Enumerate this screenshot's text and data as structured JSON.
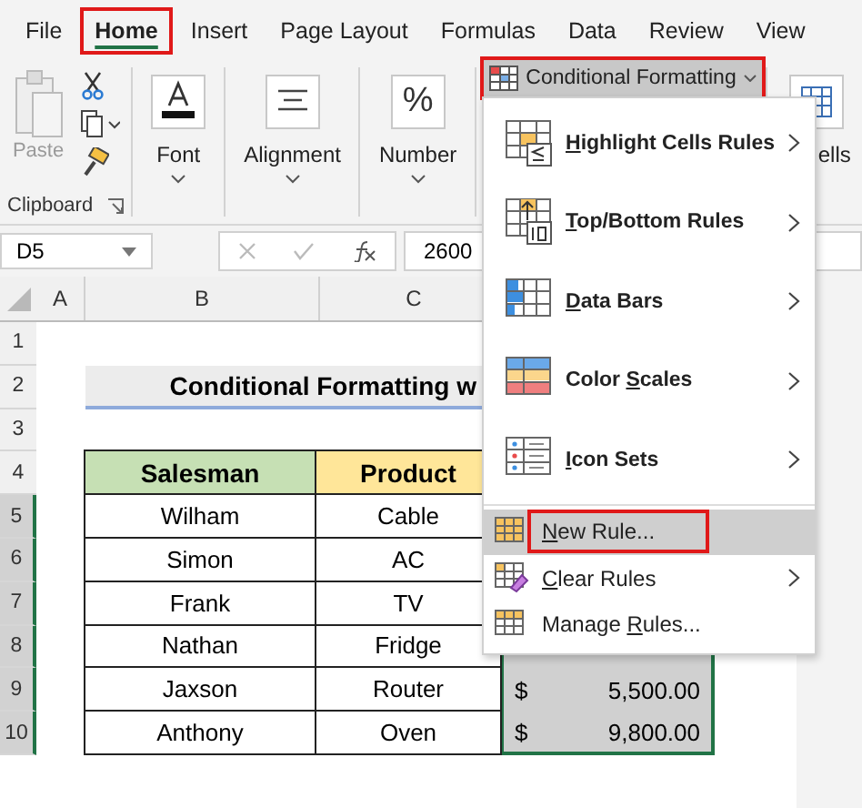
{
  "ribbon_tabs": [
    {
      "label": "File",
      "selected": false
    },
    {
      "label": "Home",
      "selected": true
    },
    {
      "label": "Insert",
      "selected": false
    },
    {
      "label": "Page Layout",
      "selected": false
    },
    {
      "label": "Formulas",
      "selected": false
    },
    {
      "label": "Data",
      "selected": false
    },
    {
      "label": "Review",
      "selected": false
    },
    {
      "label": "View",
      "selected": false
    }
  ],
  "clipboard": {
    "paste": "Paste",
    "group": "Clipboard"
  },
  "groups": [
    {
      "label": "Font",
      "kind": "font"
    },
    {
      "label": "Alignment",
      "kind": "align"
    },
    {
      "label": "Number",
      "kind": "number",
      "glyph": "%"
    }
  ],
  "conditional_formatting": {
    "label": "Conditional Formatting"
  },
  "cells_group": {
    "label": "ells"
  },
  "formula_bar": {
    "name_box": "D5",
    "value": "2600"
  },
  "columns": [
    "A",
    "B",
    "C"
  ],
  "title": "Conditional Formatting w",
  "headers": [
    {
      "label": "Salesman",
      "color": "#c6e0b4"
    },
    {
      "label": "Product",
      "color": "#ffe699"
    }
  ],
  "rows": [
    {
      "num": "1"
    },
    {
      "num": "2"
    },
    {
      "num": "3"
    },
    {
      "num": "4"
    },
    {
      "num": "5",
      "cells": [
        "Wilham",
        "Cable"
      ]
    },
    {
      "num": "6",
      "cells": [
        "Simon",
        "AC"
      ]
    },
    {
      "num": "7",
      "cells": [
        "Frank",
        "TV"
      ]
    },
    {
      "num": "8",
      "cells": [
        "Nathan",
        "Fridge"
      ]
    },
    {
      "num": "9",
      "cells": [
        "Jaxson",
        "Router"
      ],
      "currency": "$",
      "amount": "5,500.00"
    },
    {
      "num": "10",
      "cells": [
        "Anthony",
        "Oven"
      ],
      "currency": "$",
      "amount": "9,800.00"
    }
  ],
  "menu": [
    {
      "kind": "big",
      "key": "H",
      "post": "ighlight Cells Rules",
      "submenu": true,
      "selected": false
    },
    {
      "kind": "big",
      "key": "T",
      "post": "op/Bottom Rules",
      "submenu": true,
      "selected": false
    },
    {
      "kind": "big",
      "key": "D",
      "post": "ata Bars",
      "submenu": true,
      "selected": false
    },
    {
      "kind": "big",
      "pre": "Color ",
      "key": "S",
      "post": "cales",
      "submenu": true,
      "selected": false
    },
    {
      "kind": "big",
      "key": "I",
      "post": "con Sets",
      "submenu": true,
      "selected": false
    },
    {
      "kind": "small",
      "key": "N",
      "post": "ew Rule...",
      "submenu": false,
      "selected": true
    },
    {
      "kind": "small",
      "key": "C",
      "post": "lear Rules",
      "submenu": true,
      "selected": false
    },
    {
      "kind": "small",
      "pre": "Manage ",
      "key": "R",
      "post": "ules...",
      "submenu": false,
      "selected": false
    }
  ]
}
